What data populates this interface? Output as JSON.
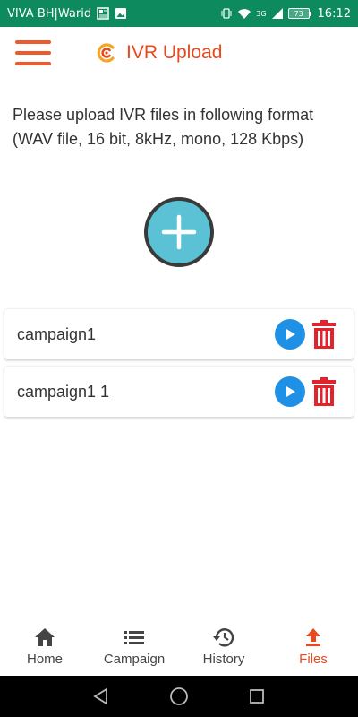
{
  "status_bar": {
    "carrier": "VIVA BH|Warid",
    "network": "3G",
    "battery": "73",
    "time": "16:12"
  },
  "app_bar": {
    "title": "IVR Upload",
    "menu_icon": "hamburger-menu-icon",
    "logo_icon": "app-logo-icon"
  },
  "instructions": {
    "line1": "Please upload IVR files in following format",
    "line2": "(WAV file, 16 bit, 8kHz, mono, 128 Kbps)"
  },
  "files": [
    {
      "name": "campaign1"
    },
    {
      "name": "campaign1 1"
    }
  ],
  "bottom_nav": [
    {
      "label": "Home",
      "icon": "home-icon",
      "active": false
    },
    {
      "label": "Campaign",
      "icon": "list-icon",
      "active": false
    },
    {
      "label": "History",
      "icon": "history-icon",
      "active": false
    },
    {
      "label": "Files",
      "icon": "upload-icon",
      "active": true
    }
  ],
  "colors": {
    "status_bar": "#0e8a5f",
    "accent": "#e8491d",
    "add_button": "#5bc2d6",
    "play_button": "#1e90e6",
    "delete_icon": "#e3222b"
  }
}
